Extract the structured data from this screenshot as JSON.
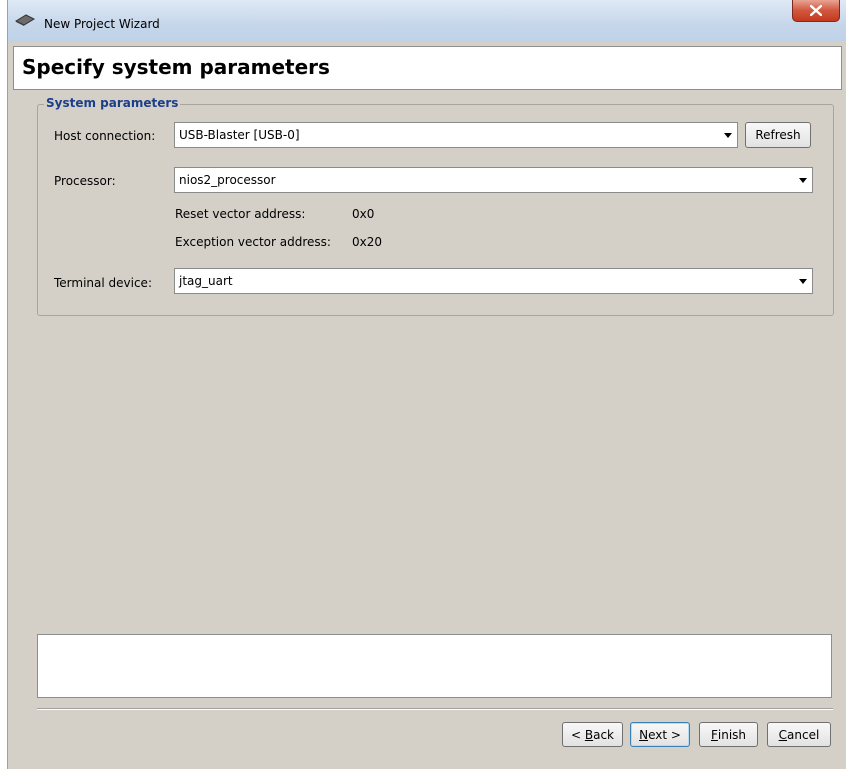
{
  "window": {
    "title": "New Project Wizard"
  },
  "header": {
    "title": "Specify system parameters"
  },
  "group": {
    "legend": "System parameters",
    "host_connection": {
      "label": "Host connection:",
      "value": "USB-Blaster [USB-0]",
      "refresh": "Refresh"
    },
    "processor": {
      "label": "Processor:",
      "value": "nios2_processor"
    },
    "reset_vector": {
      "label": "Reset vector address:",
      "value": "0x0"
    },
    "exception_vector": {
      "label": "Exception vector address:",
      "value": "0x20"
    },
    "terminal_device": {
      "label": "Terminal device:",
      "value": "jtag_uart"
    }
  },
  "message": "",
  "buttons": {
    "back": {
      "prefix": "< ",
      "mnemonic": "B",
      "rest": "ack"
    },
    "next": {
      "mnemonic": "N",
      "rest": "ext >"
    },
    "finish": {
      "mnemonic": "F",
      "rest": "inish"
    },
    "cancel": {
      "mnemonic": "C",
      "rest": "ancel"
    }
  },
  "icons": {
    "app": "chip-icon",
    "close": "close-icon"
  },
  "colors": {
    "dialog_bg": "#d4d0c8",
    "legend": "#1c3f8a",
    "close": "#c4391e"
  }
}
